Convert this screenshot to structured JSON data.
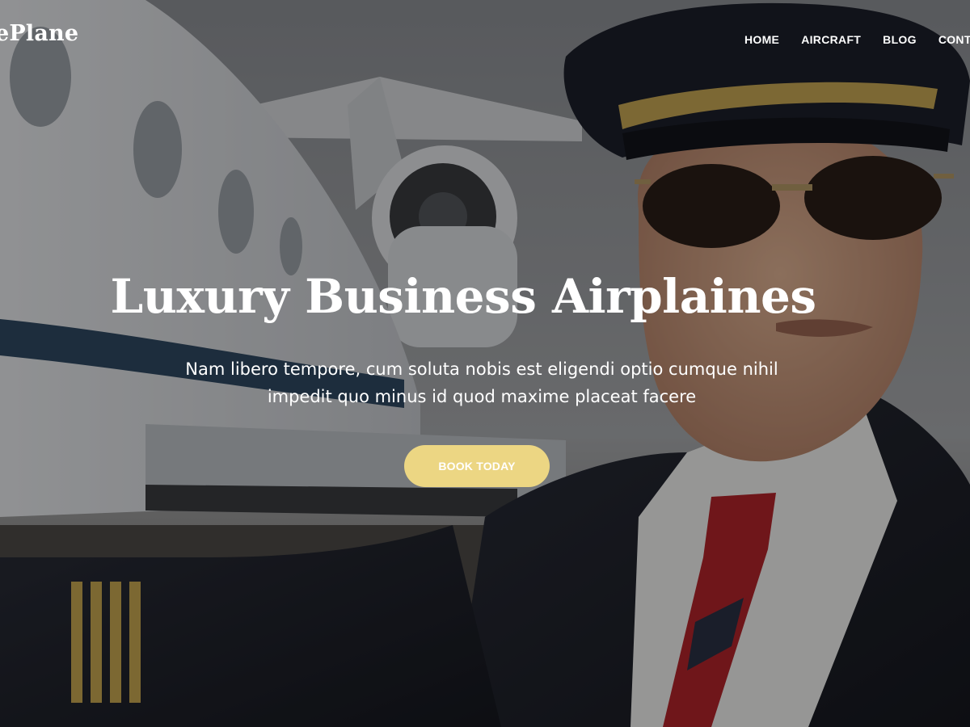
{
  "brand": {
    "logo_text": "ePlane"
  },
  "nav": {
    "items": [
      {
        "label": "HOME"
      },
      {
        "label": "AIRCRAFT"
      },
      {
        "label": "BLOG"
      },
      {
        "label": "CONTACT"
      }
    ]
  },
  "hero": {
    "title": "Luxury Business Airplaines",
    "subtitle": "Nam libero tempore, cum soluta nobis est eligendi optio cumque nihil impedit quo minus id quod maxime placeat facere",
    "cta_label": "BOOK TODAY"
  },
  "colors": {
    "accent": "#ecd683",
    "text": "#ffffff",
    "overlay": "rgba(0,0,0,0.38)"
  }
}
